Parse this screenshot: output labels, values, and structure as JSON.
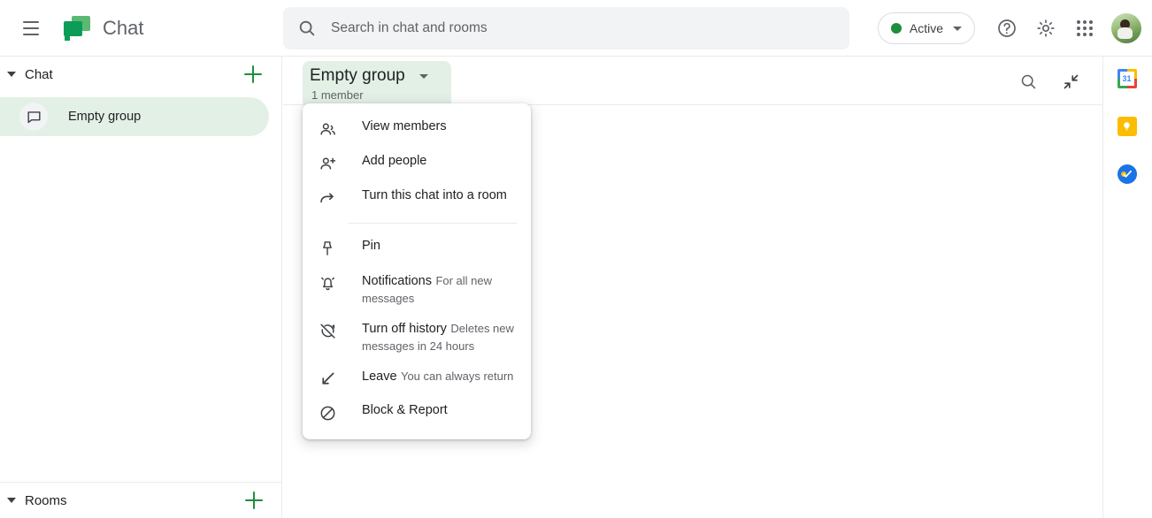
{
  "app": {
    "title": "Chat",
    "logo_icon": "google-chat-logo",
    "menu_icon": "hamburger-menu-icon"
  },
  "search": {
    "placeholder": "Search in chat and rooms",
    "value": "",
    "icon": "search-icon"
  },
  "header_actions": {
    "status": {
      "label": "Active",
      "dot_color": "#1e8e3e",
      "caret_icon": "chevron-down-icon"
    },
    "help_icon": "help-circle-icon",
    "settings_icon": "gear-icon",
    "apps_icon": "apps-grid-icon",
    "avatar_icon": "user-avatar"
  },
  "sidebar": {
    "chat_section": {
      "title": "Chat",
      "collapse_icon": "triangle-down-icon",
      "add_label": "+",
      "items": [
        {
          "name": "Empty group",
          "icon": "chat-bubble-icon",
          "selected": true
        }
      ]
    },
    "rooms_section": {
      "title": "Rooms",
      "collapse_icon": "triangle-down-icon",
      "add_label": "+"
    }
  },
  "room": {
    "title": "Empty group",
    "subtitle": "1 member",
    "caret_icon": "chevron-down-icon",
    "actions": {
      "search_icon": "search-icon",
      "collapse_icon": "collapse-arrows-icon"
    }
  },
  "menu": {
    "items": [
      {
        "label": "View members",
        "desc": "",
        "icon": "people-icon"
      },
      {
        "label": "Add people",
        "desc": "",
        "icon": "person-add-icon"
      },
      {
        "label": "Turn this chat into a room",
        "desc": "",
        "icon": "arrow-forward-icon"
      },
      {
        "divider": true
      },
      {
        "label": "Pin",
        "desc": "",
        "icon": "pin-icon"
      },
      {
        "label": "Notifications",
        "desc": "For all new messages",
        "icon": "bell-icon"
      },
      {
        "label": "Turn off history",
        "desc": "Deletes new messages in 24 hours",
        "icon": "history-off-icon"
      },
      {
        "label": "Leave",
        "desc": "You can always return",
        "icon": "leave-arrow-icon"
      },
      {
        "label": "Block & Report",
        "desc": "",
        "icon": "block-icon"
      }
    ]
  },
  "rail": {
    "items": [
      {
        "name": "Google Calendar",
        "icon": "calendar-icon",
        "day": "31"
      },
      {
        "name": "Google Keep",
        "icon": "keep-bulb-icon"
      },
      {
        "name": "Google Tasks",
        "icon": "tasks-check-icon"
      }
    ]
  },
  "colors": {
    "accent_green": "#1e8e3e",
    "selected_bg": "#e3f0e5",
    "text_primary": "#202124",
    "text_secondary": "#5f6368"
  }
}
